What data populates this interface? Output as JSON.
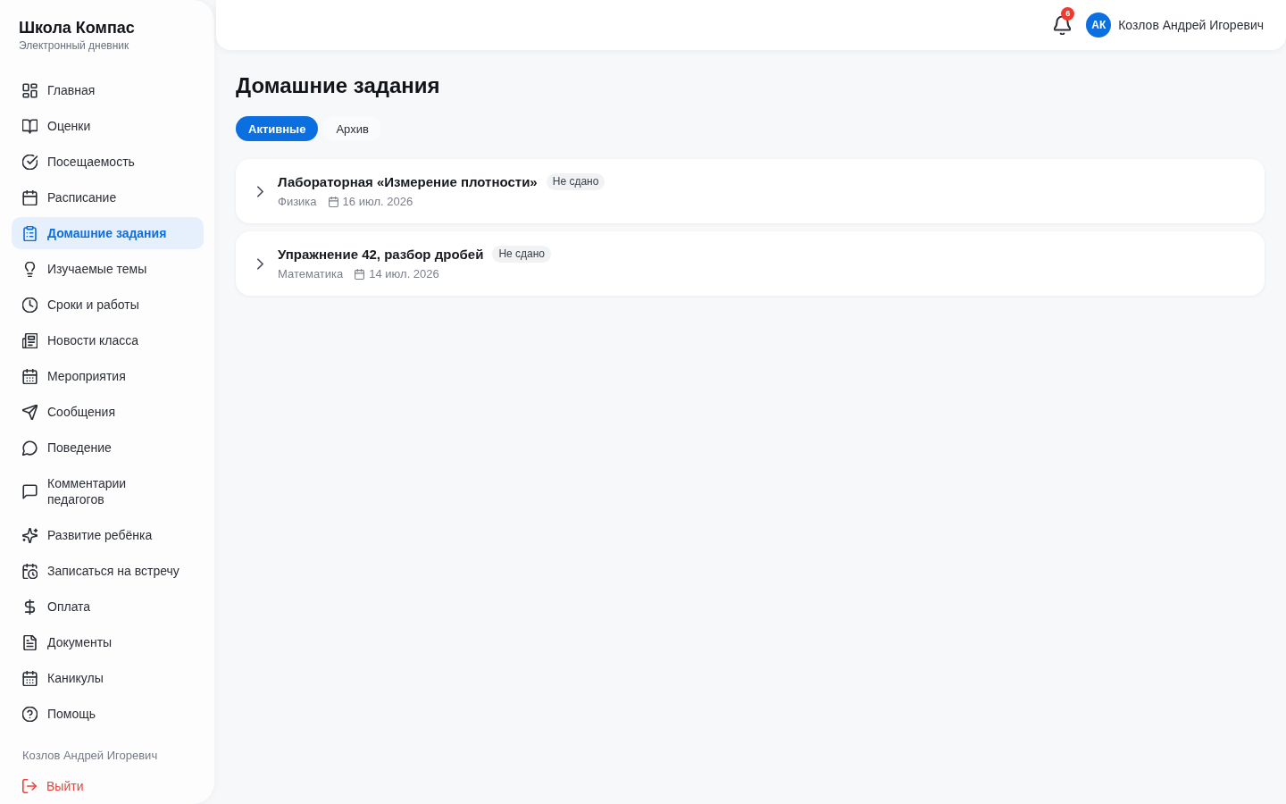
{
  "sidebar": {
    "brand": {
      "title": "Школа Компас",
      "subtitle": "Электронный дневник"
    },
    "items": [
      {
        "label": "Главная",
        "selected": false
      },
      {
        "label": "Оценки",
        "selected": false
      },
      {
        "label": "Посещаемость",
        "selected": false
      },
      {
        "label": "Расписание",
        "selected": false
      },
      {
        "label": "Домашние задания",
        "selected": true
      },
      {
        "label": "Изучаемые темы",
        "selected": false
      },
      {
        "label": "Сроки и работы",
        "selected": false
      },
      {
        "label": "Новости класса",
        "selected": false
      },
      {
        "label": "Мероприятия",
        "selected": false
      },
      {
        "label": "Сообщения",
        "selected": false
      },
      {
        "label": "Поведение",
        "selected": false
      },
      {
        "label": "Комментарии педагогов",
        "selected": false
      },
      {
        "label": "Развитие ребёнка",
        "selected": false
      },
      {
        "label": "Записаться на встречу",
        "selected": false
      },
      {
        "label": "Оплата",
        "selected": false
      },
      {
        "label": "Документы",
        "selected": false
      },
      {
        "label": "Каникулы",
        "selected": false
      },
      {
        "label": "Помощь",
        "selected": false
      }
    ],
    "user_name": "Козлов Андрей Игоревич",
    "logout": "Выйти"
  },
  "header": {
    "notification_count": "6",
    "user": {
      "initials": "АК",
      "name": "Козлов Андрей Игоревич"
    }
  },
  "page": {
    "title": "Домашние задания",
    "tabs": [
      {
        "label": "Активные",
        "selected": true
      },
      {
        "label": "Архив",
        "selected": false
      }
    ],
    "assignments": [
      {
        "title": "Лабораторная «Измерение плотности»",
        "status": "Не сдано",
        "subject": "Физика",
        "due": "16 июл. 2026",
        "expanded": false
      },
      {
        "title": "Упражнение 42, разбор дробей",
        "status": "Не сдано",
        "subject": "Математика",
        "due": "14 июл. 2026",
        "expanded": false
      }
    ]
  }
}
